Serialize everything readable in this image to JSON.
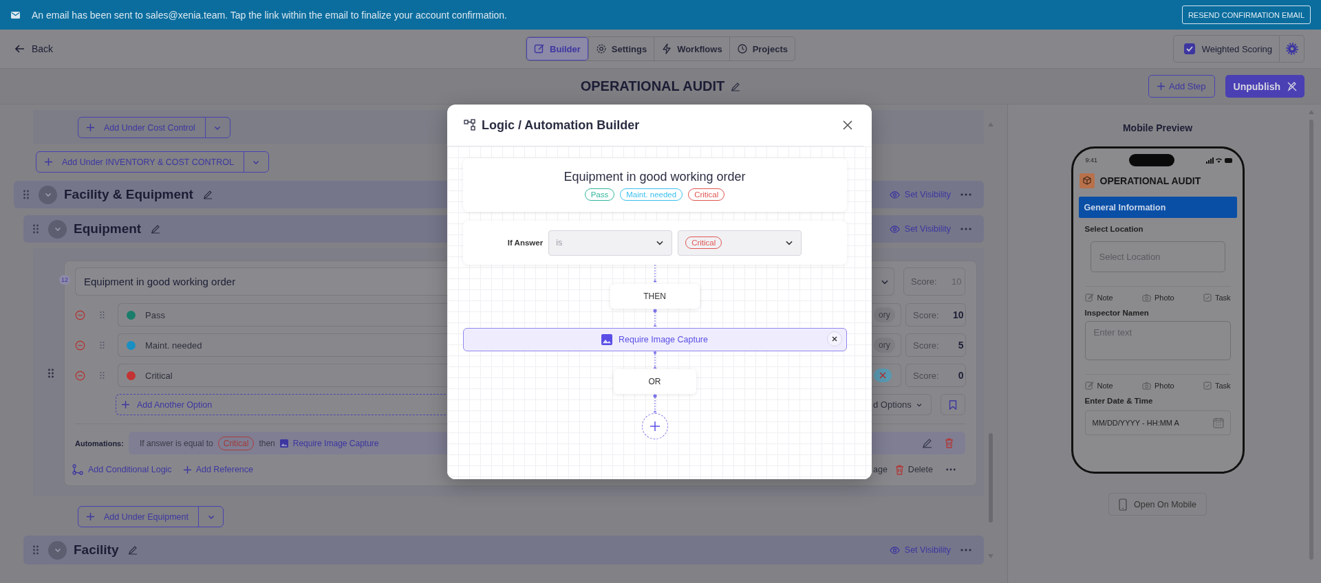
{
  "banner": {
    "message": "An email has been sent to sales@xenia.team. Tap the link within the email to finalize your account confirmation.",
    "button": "RESEND CONFIRMATION EMAIL"
  },
  "header": {
    "back": "Back",
    "tabs": [
      {
        "label": "Builder",
        "selected": true
      },
      {
        "label": "Settings",
        "selected": false
      },
      {
        "label": "Workflows",
        "selected": false
      },
      {
        "label": "Projects",
        "selected": false
      }
    ],
    "weighted_scoring": {
      "label": "Weighted Scoring",
      "checked": true
    }
  },
  "title_bar": {
    "title": "OPERATIONAL AUDIT",
    "add_step": "Add Step",
    "unpublish": "Unpublish"
  },
  "builder": {
    "add_under_cost_control": "Add Under Cost Control",
    "add_under_inventory": "Add Under INVENTORY & COST CONTROL",
    "section": {
      "title": "Facility & Equipment",
      "visibility": "Set Visibility"
    },
    "subsection": {
      "title": "Equipment",
      "visibility": "Set Visibility"
    },
    "question": {
      "number": "12",
      "text": "Equipment in good working order",
      "score_label": "Score:",
      "score_placeholder": "10",
      "options": [
        {
          "label": "Pass",
          "color": "#1a7d6b",
          "kind": "category",
          "tag_text": "ory",
          "score_label": "Score:",
          "score": "10"
        },
        {
          "label": "Maint. needed",
          "color": "#1a8fc2",
          "kind": "category",
          "tag_text": "ory",
          "score_label": "Score:",
          "score": "5"
        },
        {
          "label": "Critical",
          "color": "#c33333",
          "kind": "clear",
          "score_label": "Score:",
          "score": "0"
        }
      ],
      "add_option": "Add Another Option",
      "options_menu": "d Options",
      "automations_label": "Automations:",
      "automation": {
        "prefix": "If answer is equal to",
        "value": "Critical",
        "then": "then",
        "action": "Require Image Capture"
      },
      "add_logic": "Add Conditional Logic",
      "add_reference": "Add Reference",
      "image_action": "age",
      "delete": "Delete"
    },
    "add_under_equipment": "Add Under Equipment",
    "next_section": {
      "title": "Facility",
      "visibility": "Set Visibility"
    }
  },
  "modal": {
    "title": "Logic / Automation Builder",
    "question": "Equipment in good working order",
    "chips": [
      {
        "label": "Pass",
        "color": "#2fb59b"
      },
      {
        "label": "Maint. needed",
        "color": "#3bbfef"
      },
      {
        "label": "Critical",
        "color": "#e05550"
      }
    ],
    "condition": {
      "label": "If Answer",
      "operator": "is",
      "value": "Critical"
    },
    "then": "THEN",
    "action": "Require Image Capture",
    "or": "OR"
  },
  "preview": {
    "heading": "Mobile Preview",
    "time": "9:41",
    "title": "OPERATIONAL AUDIT",
    "section": "General Information",
    "fields": [
      {
        "label": "Select Location",
        "kind": "select",
        "placeholder": "Select Location",
        "actions": [
          "Note",
          "Photo",
          "Task"
        ]
      },
      {
        "label": "Inspector Namen",
        "kind": "textarea",
        "placeholder": "Enter text",
        "actions": [
          "Note",
          "Photo",
          "Task"
        ]
      },
      {
        "label": "Enter Date & Time",
        "kind": "datetime",
        "placeholder": "MM/DD/YYYY - HH:MM A"
      }
    ],
    "open_button": "Open On Mobile"
  }
}
